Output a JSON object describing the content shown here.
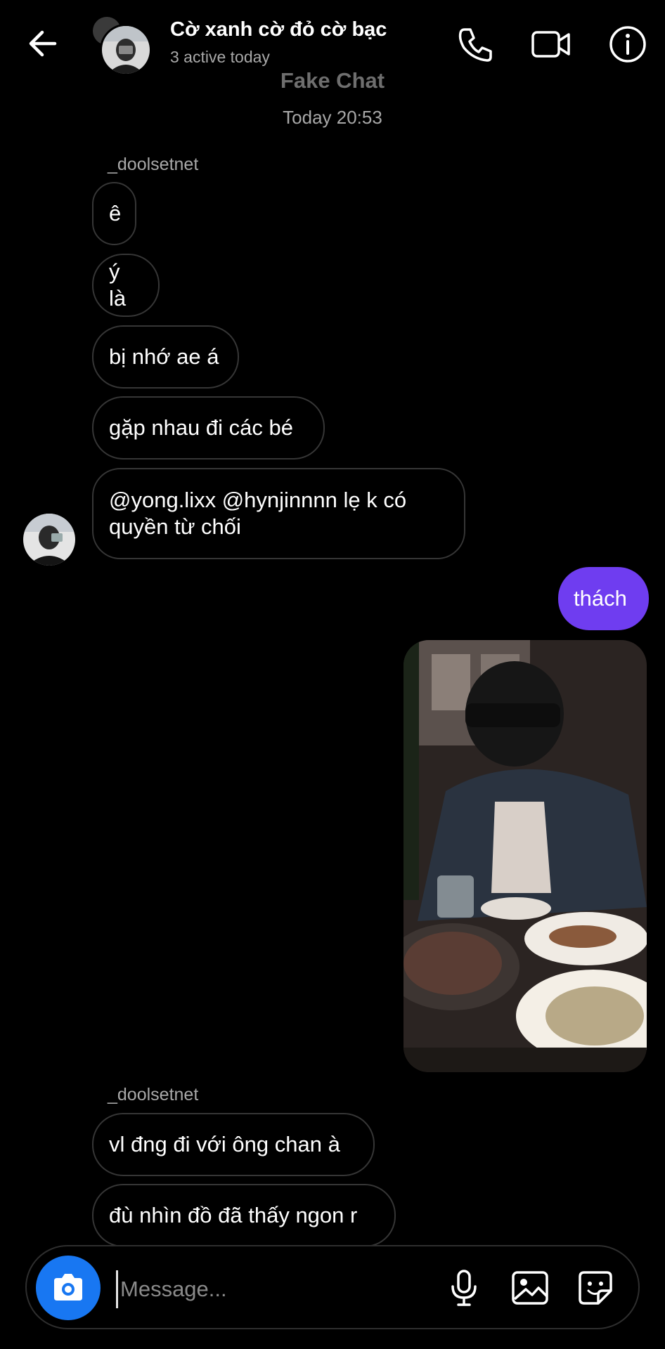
{
  "header": {
    "title": "Cờ xanh cờ đỏ cờ bạc",
    "subtitle": "3 active today",
    "icons": [
      "back-arrow-icon",
      "phone-icon",
      "video-camera-icon",
      "info-icon"
    ]
  },
  "watermark": "Fake Chat",
  "timestamp": "Today 20:53",
  "messages_group1": {
    "sender": "_doolsetnet",
    "items": [
      "ê",
      "ý là",
      "bị nhớ ae á",
      "gặp nhau đi các bé",
      "@yong.lixx @hynjinnnn lẹ k có quyền từ chối"
    ],
    "multi_line_1": "@yong.lixx @hynjinnnn lẹ k có",
    "multi_line_2": "quyền từ chối"
  },
  "sent_message": "thách",
  "messages_group2": {
    "sender": "_doolsetnet",
    "items": [
      "vl đng đi với ông chan à",
      "đù nhìn đồ đã thấy ngon r"
    ]
  },
  "composer": {
    "placeholder": "Message...",
    "icons": [
      "camera-icon",
      "microphone-icon",
      "gallery-icon",
      "sticker-icon"
    ]
  },
  "colors": {
    "background": "#000000",
    "sent_bubble": "#6f3df0",
    "camera_button": "#1877f2",
    "secondary_text": "#a8a8a8"
  }
}
